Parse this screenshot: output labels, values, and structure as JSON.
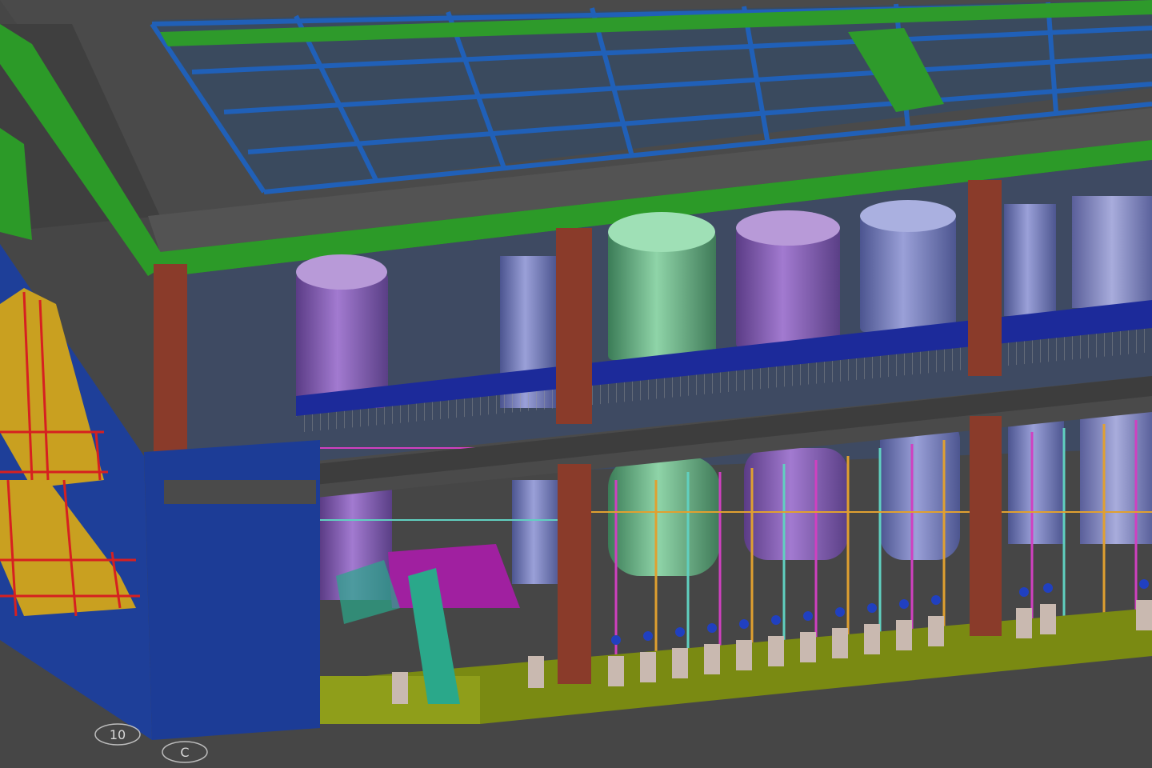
{
  "viewport": {
    "background": "#464646"
  },
  "palette": {
    "slab": "#4f4f4f",
    "beam_blue": "#1f5fae",
    "beam_green": "#2f9a2a",
    "column": "#8a3b2a",
    "wall_blue": "#1e3f99",
    "floor": "#7a8a12",
    "tank_purple": "#8a5bb0",
    "tank_green": "#5fae7d",
    "tank_lavender": "#7a7fc0",
    "stair_red": "#d62020",
    "stair_yellow": "#c9a020",
    "stair_teal": "#2aa88a",
    "walkway": "#1c2a9a",
    "pipe_magenta": "#d040c0",
    "pipe_orange": "#e0a030",
    "pipe_cyan": "#60d0c0"
  },
  "grid_markers": [
    {
      "label": "10"
    },
    {
      "label": "C"
    }
  ]
}
